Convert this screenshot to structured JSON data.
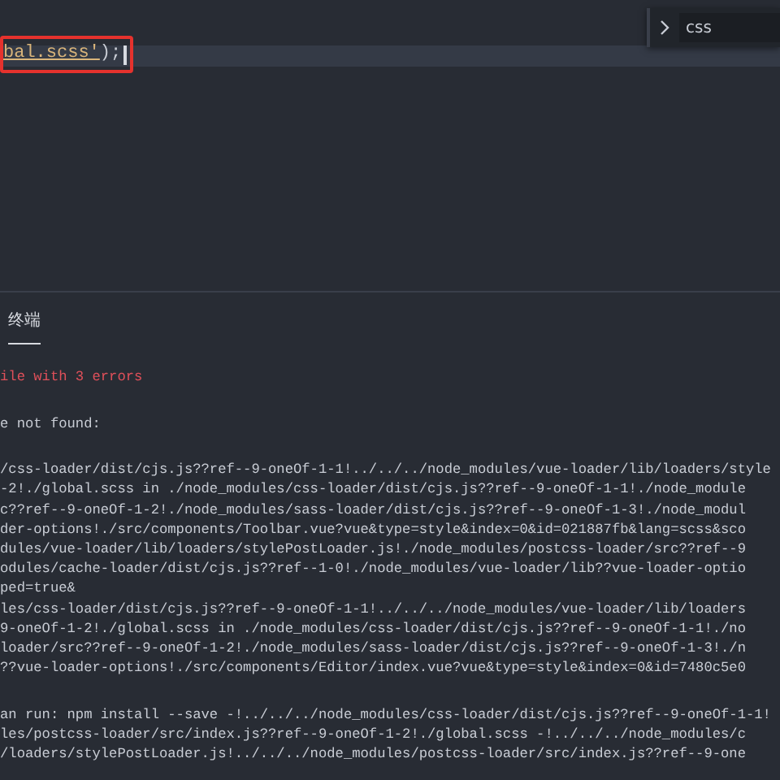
{
  "editor": {
    "code_tokens": [
      {
        "kind": "string",
        "text": "bal.scss'"
      },
      {
        "kind": "punct",
        "text": ");"
      }
    ],
    "find_widget": {
      "value": "css"
    }
  },
  "panel": {
    "tabs": [
      {
        "label": "终端",
        "selected": true
      }
    ]
  },
  "terminal": {
    "lines": [
      {
        "kind": "error",
        "text": "ile with 3 errors"
      },
      {
        "kind": "blank"
      },
      {
        "kind": "plain",
        "text": "e not found:"
      },
      {
        "kind": "blank"
      },
      {
        "kind": "plain",
        "text": "/css-loader/dist/cjs.js??ref--9-oneOf-1-1!../../../node_modules/vue-loader/lib/loaders/style"
      },
      {
        "kind": "plain",
        "text": "-2!./global.scss in ./node_modules/css-loader/dist/cjs.js??ref--9-oneOf-1-1!./node_module"
      },
      {
        "kind": "plain",
        "text": "c??ref--9-oneOf-1-2!./node_modules/sass-loader/dist/cjs.js??ref--9-oneOf-1-3!./node_modul"
      },
      {
        "kind": "plain",
        "text": "der-options!./src/components/Toolbar.vue?vue&type=style&index=0&id=021887fb&lang=scss&sco"
      },
      {
        "kind": "plain",
        "text": "dules/vue-loader/lib/loaders/stylePostLoader.js!./node_modules/postcss-loader/src??ref--9"
      },
      {
        "kind": "plain",
        "text": "odules/cache-loader/dist/cjs.js??ref--1-0!./node_modules/vue-loader/lib??vue-loader-optio"
      },
      {
        "kind": "plain",
        "text": "ped=true&"
      },
      {
        "kind": "plain",
        "text": "les/css-loader/dist/cjs.js??ref--9-oneOf-1-1!../../../node_modules/vue-loader/lib/loaders"
      },
      {
        "kind": "plain",
        "text": "9-oneOf-1-2!./global.scss in ./node_modules/css-loader/dist/cjs.js??ref--9-oneOf-1-1!./no"
      },
      {
        "kind": "plain",
        "text": "loader/src??ref--9-oneOf-1-2!./node_modules/sass-loader/dist/cjs.js??ref--9-oneOf-1-3!./n"
      },
      {
        "kind": "plain",
        "text": "??vue-loader-options!./src/components/Editor/index.vue?vue&type=style&index=0&id=7480c5e0"
      },
      {
        "kind": "blank"
      },
      {
        "kind": "plain",
        "text": "an run: npm install --save -!../../../node_modules/css-loader/dist/cjs.js??ref--9-oneOf-1-1!"
      },
      {
        "kind": "plain",
        "text": "les/postcss-loader/src/index.js??ref--9-oneOf-1-2!./global.scss -!../../../node_modules/c"
      },
      {
        "kind": "plain",
        "text": "/loaders/stylePostLoader.js!../../../node_modules/postcss-loader/src/index.js??ref--9-one"
      }
    ]
  }
}
